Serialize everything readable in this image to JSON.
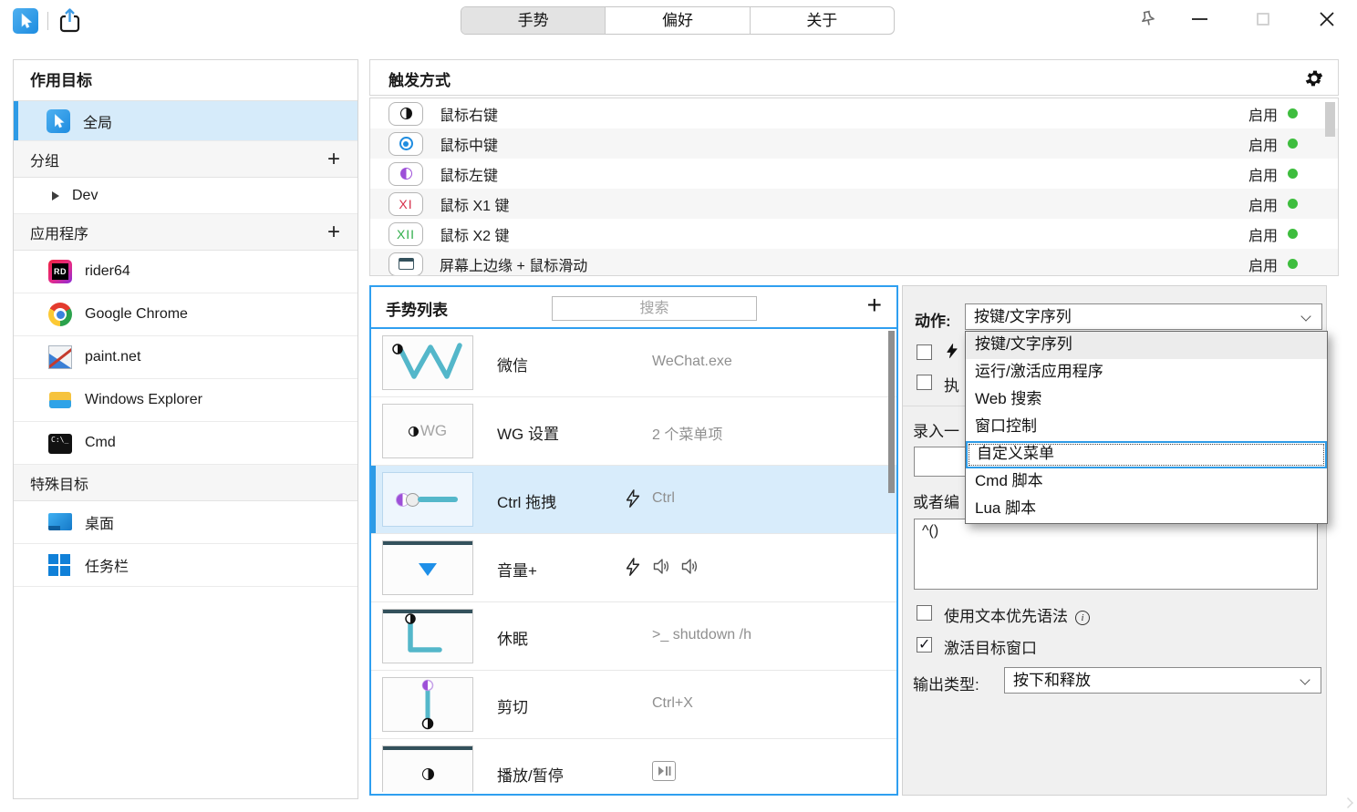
{
  "titlebar": {
    "tabs": [
      {
        "label": "手势"
      },
      {
        "label": "偏好"
      },
      {
        "label": "关于"
      }
    ]
  },
  "sidebar": {
    "header": "作用目标",
    "global_label": "全局",
    "groups": {
      "label": "分组",
      "add": "+"
    },
    "group_items": [
      {
        "label": "Dev"
      }
    ],
    "apps_section": {
      "label": "应用程序",
      "add": "+"
    },
    "apps": [
      {
        "label": "rider64"
      },
      {
        "label": "Google Chrome"
      },
      {
        "label": "paint.net"
      },
      {
        "label": "Windows Explorer"
      },
      {
        "label": "Cmd"
      }
    ],
    "special_section": {
      "label": "特殊目标"
    },
    "specials": [
      {
        "label": "桌面"
      },
      {
        "label": "任务栏"
      }
    ]
  },
  "triggers": {
    "header": "触发方式",
    "rows": [
      {
        "label": "鼠标右键",
        "status": "启用"
      },
      {
        "label": "鼠标中键",
        "status": "启用"
      },
      {
        "label": "鼠标左键",
        "status": "启用"
      },
      {
        "label": "鼠标 X1 键",
        "badge": "XI",
        "status": "启用"
      },
      {
        "label": "鼠标 X2 键",
        "badge": "XII",
        "status": "启用"
      },
      {
        "label": "屏幕上边缘 + 鼠标滑动",
        "status": "启用"
      }
    ]
  },
  "gestures": {
    "header": "手势列表",
    "search_placeholder": "搜索",
    "add": "+",
    "rows": [
      {
        "name": "微信",
        "extra": "WeChat.exe"
      },
      {
        "name": "WG 设置",
        "extra": "2 个菜单项",
        "badge_text": "WG"
      },
      {
        "name": "Ctrl 拖拽",
        "extra": "Ctrl"
      },
      {
        "name": "音量+",
        "extra": ""
      },
      {
        "name": "休眠",
        "extra": ">_ shutdown /h"
      },
      {
        "name": "剪切",
        "extra": "Ctrl+X"
      },
      {
        "name": "播放/暂停",
        "extra": ""
      }
    ]
  },
  "action_panel": {
    "action_label": "动作:",
    "action_value": "按键/文字序列",
    "partial_checkbox_label": "执",
    "record_label": "录入一",
    "edit_label": "或者编",
    "sequence_value": "^()",
    "text_first_label": "使用文本优先语法",
    "activate_label": "激活目标窗口",
    "output_label": "输出类型:",
    "output_value": "按下和释放",
    "dropdown_items": [
      "按键/文字序列",
      "运行/激活应用程序",
      "Web 搜索",
      "窗口控制",
      "自定义菜单",
      "Cmd 脚本",
      "Lua 脚本"
    ]
  },
  "colors": {
    "accent_blue": "#2e9be6",
    "panel_focus_blue": "#2f9ff0",
    "selected_row_bg": "#d8ecfb",
    "enabled_green": "#3ebd3e",
    "gesture_teal": "#54b7ca",
    "left_button_purple": "#9d4fd8",
    "x1_red": "#d62e4a",
    "x2_green": "#2fae4a",
    "middle_button_blue": "#1e8ce0"
  }
}
